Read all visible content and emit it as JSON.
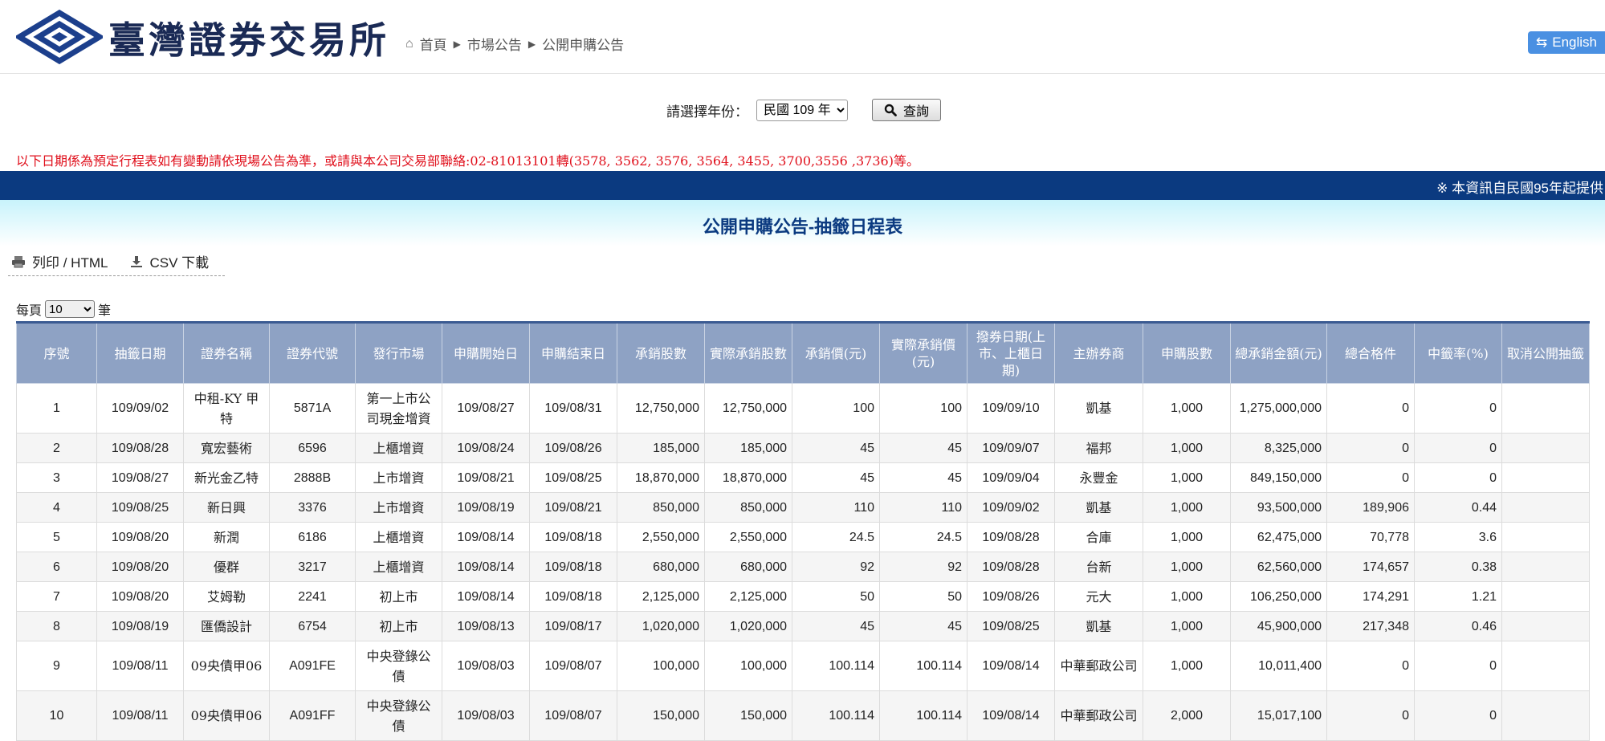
{
  "header": {
    "brand": "臺灣證券交易所",
    "breadcrumb": [
      "首頁",
      "市場公告",
      "公開申購公告"
    ],
    "english_label": "English"
  },
  "filter": {
    "year_label": "請選擇年份：",
    "year_value": "民國 109 年",
    "query_label": "查詢"
  },
  "notice": "以下日期係為預定行程表如有變動請依現場公告為準，或請與本公司交易部聯絡:02-81013101轉(3578, 3562, 3576, 3564, 3455, 3700,3556 ,3736)等。",
  "info_bar": "※ 本資訊自民國95年起提供",
  "page_title": "公開申購公告-抽籤日程表",
  "tools": {
    "print_label": "列印 / HTML",
    "csv_label": "CSV 下載"
  },
  "per_page": {
    "prefix": "每頁",
    "value": "10",
    "suffix": "筆"
  },
  "table": {
    "headers": [
      "序號",
      "抽籤日期",
      "證券名稱",
      "證券代號",
      "發行市場",
      "申購開始日",
      "申購結束日",
      "承銷股數",
      "實際承銷股數",
      "承銷價(元)",
      "實際承銷價(元)",
      "撥券日期(上市、上櫃日期)",
      "主辦券商",
      "申購股數",
      "總承銷金額(元)",
      "總合格件",
      "中籤率(%)",
      "取消公開抽籤"
    ],
    "rows": [
      [
        "1",
        "109/09/02",
        "中租-KY 甲特",
        "5871A",
        "第一上市公司現金增資",
        "109/08/27",
        "109/08/31",
        "12,750,000",
        "12,750,000",
        "100",
        "100",
        "109/09/10",
        "凱基",
        "1,000",
        "1,275,000,000",
        "0",
        "0",
        ""
      ],
      [
        "2",
        "109/08/28",
        "寬宏藝術",
        "6596",
        "上櫃增資",
        "109/08/24",
        "109/08/26",
        "185,000",
        "185,000",
        "45",
        "45",
        "109/09/07",
        "福邦",
        "1,000",
        "8,325,000",
        "0",
        "0",
        ""
      ],
      [
        "3",
        "109/08/27",
        "新光金乙特",
        "2888B",
        "上市增資",
        "109/08/21",
        "109/08/25",
        "18,870,000",
        "18,870,000",
        "45",
        "45",
        "109/09/04",
        "永豐金",
        "1,000",
        "849,150,000",
        "0",
        "0",
        ""
      ],
      [
        "4",
        "109/08/25",
        "新日興",
        "3376",
        "上市增資",
        "109/08/19",
        "109/08/21",
        "850,000",
        "850,000",
        "110",
        "110",
        "109/09/02",
        "凱基",
        "1,000",
        "93,500,000",
        "189,906",
        "0.44",
        ""
      ],
      [
        "5",
        "109/08/20",
        "新潤",
        "6186",
        "上櫃增資",
        "109/08/14",
        "109/08/18",
        "2,550,000",
        "2,550,000",
        "24.5",
        "24.5",
        "109/08/28",
        "合庫",
        "1,000",
        "62,475,000",
        "70,778",
        "3.6",
        ""
      ],
      [
        "6",
        "109/08/20",
        "優群",
        "3217",
        "上櫃增資",
        "109/08/14",
        "109/08/18",
        "680,000",
        "680,000",
        "92",
        "92",
        "109/08/28",
        "台新",
        "1,000",
        "62,560,000",
        "174,657",
        "0.38",
        ""
      ],
      [
        "7",
        "109/08/20",
        "艾姆勒",
        "2241",
        "初上市",
        "109/08/14",
        "109/08/18",
        "2,125,000",
        "2,125,000",
        "50",
        "50",
        "109/08/26",
        "元大",
        "1,000",
        "106,250,000",
        "174,291",
        "1.21",
        ""
      ],
      [
        "8",
        "109/08/19",
        "匯僑設計",
        "6754",
        "初上市",
        "109/08/13",
        "109/08/17",
        "1,020,000",
        "1,020,000",
        "45",
        "45",
        "109/08/25",
        "凱基",
        "1,000",
        "45,900,000",
        "217,348",
        "0.46",
        ""
      ],
      [
        "9",
        "109/08/11",
        "09央債甲06",
        "A091FE",
        "中央登錄公債",
        "109/08/03",
        "109/08/07",
        "100,000",
        "100,000",
        "100.114",
        "100.114",
        "109/08/14",
        "中華郵政公司",
        "1,000",
        "10,011,400",
        "0",
        "0",
        ""
      ],
      [
        "10",
        "109/08/11",
        "09央債甲06",
        "A091FF",
        "中央登錄公債",
        "109/08/03",
        "109/08/07",
        "150,000",
        "150,000",
        "100.114",
        "100.114",
        "109/08/14",
        "中華郵政公司",
        "2,000",
        "15,017,100",
        "0",
        "0",
        ""
      ]
    ]
  }
}
